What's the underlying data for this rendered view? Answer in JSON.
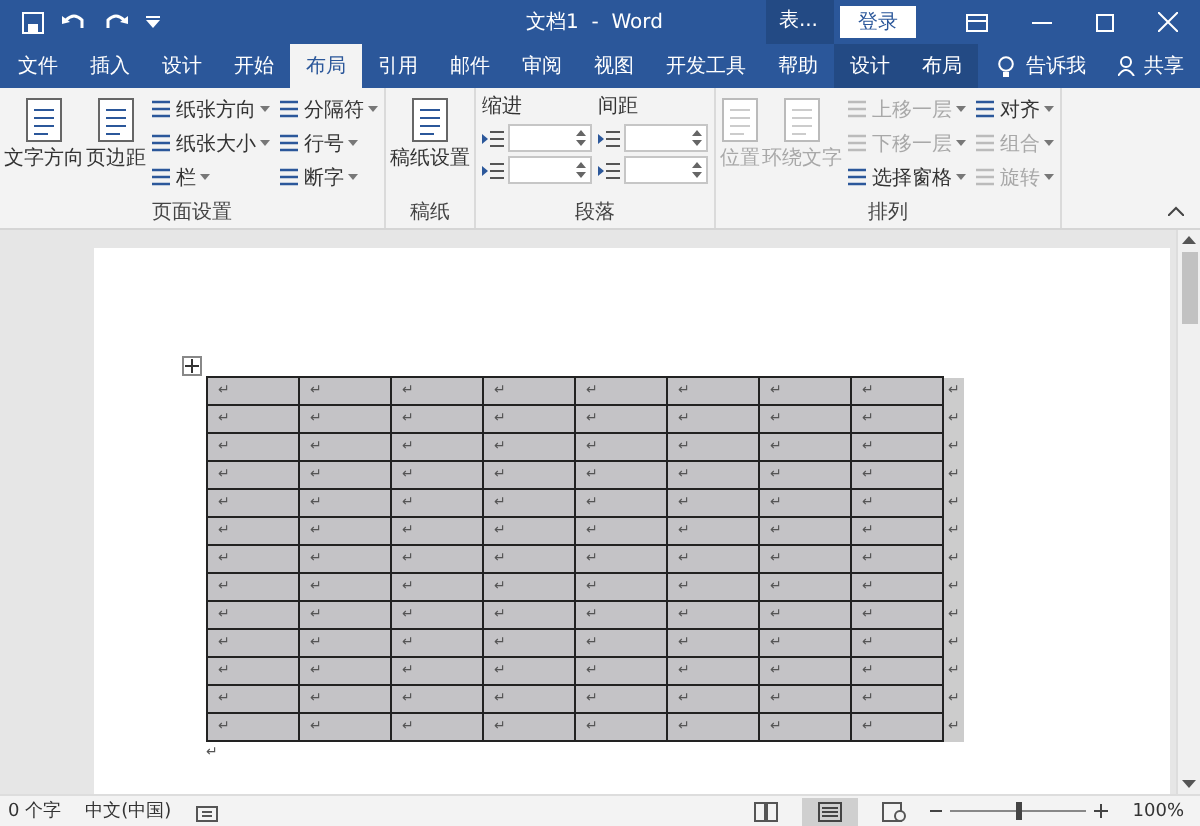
{
  "title_bar": {
    "title": "文档1  -  Word",
    "context_label": "表...",
    "login": "登录"
  },
  "tabs": [
    {
      "label": "文件",
      "selected": false,
      "kind": "normal"
    },
    {
      "label": "插入",
      "selected": false,
      "kind": "normal"
    },
    {
      "label": "设计",
      "selected": false,
      "kind": "normal"
    },
    {
      "label": "开始",
      "selected": false,
      "kind": "normal"
    },
    {
      "label": "布局",
      "selected": true,
      "kind": "normal"
    },
    {
      "label": "引用",
      "selected": false,
      "kind": "normal"
    },
    {
      "label": "邮件",
      "selected": false,
      "kind": "normal"
    },
    {
      "label": "审阅",
      "selected": false,
      "kind": "normal"
    },
    {
      "label": "视图",
      "selected": false,
      "kind": "normal"
    },
    {
      "label": "开发工具",
      "selected": false,
      "kind": "normal"
    },
    {
      "label": "帮助",
      "selected": false,
      "kind": "normal"
    },
    {
      "label": "设计",
      "selected": false,
      "kind": "context"
    },
    {
      "label": "布局",
      "selected": false,
      "kind": "context"
    }
  ],
  "tell_me": "告诉我",
  "share": "共享",
  "ribbon": [
    {
      "title": "页面设置",
      "items": [
        {
          "label": "文字方向",
          "kind": "large",
          "disabled": false
        },
        {
          "label": "页边距",
          "kind": "large",
          "disabled": false
        },
        {
          "label": "纸张方向",
          "kind": "small",
          "disabled": false
        },
        {
          "label": "纸张大小",
          "kind": "small",
          "disabled": false
        },
        {
          "label": "栏",
          "kind": "small",
          "disabled": false
        },
        {
          "label": "分隔符",
          "kind": "small",
          "disabled": false
        },
        {
          "label": "行号",
          "kind": "small",
          "disabled": false
        },
        {
          "label": "断字",
          "kind": "small",
          "disabled": false
        }
      ]
    },
    {
      "title": "稿纸",
      "items": [
        {
          "label": "稿纸设置",
          "kind": "large",
          "disabled": false
        }
      ]
    },
    {
      "title": "段落",
      "items": [
        {
          "label": "缩进",
          "kind": "spinners"
        },
        {
          "label": "间距",
          "kind": "spinners"
        }
      ]
    },
    {
      "title": "排列",
      "items": [
        {
          "label": "位置",
          "kind": "large",
          "disabled": true
        },
        {
          "label": "环绕文字",
          "kind": "large",
          "disabled": true
        },
        {
          "label": "上移一层",
          "kind": "small",
          "disabled": true
        },
        {
          "label": "下移一层",
          "kind": "small",
          "disabled": true
        },
        {
          "label": "选择窗格",
          "kind": "small",
          "disabled": false
        },
        {
          "label": "对齐",
          "kind": "small",
          "disabled": false
        },
        {
          "label": "组合",
          "kind": "small",
          "disabled": true
        },
        {
          "label": "旋转",
          "kind": "small",
          "disabled": true
        }
      ]
    }
  ],
  "table": {
    "selected": true,
    "rows": [
      {
        "cells": [
          "↵",
          "↵",
          "↵",
          "↵",
          "↵",
          "↵",
          "↵",
          "↵"
        ],
        "end": "↵"
      },
      {
        "cells": [
          "↵",
          "↵",
          "↵",
          "↵",
          "↵",
          "↵",
          "↵",
          "↵"
        ],
        "end": "↵"
      },
      {
        "cells": [
          "↵",
          "↵",
          "↵",
          "↵",
          "↵",
          "↵",
          "↵",
          "↵"
        ],
        "end": "↵"
      },
      {
        "cells": [
          "↵",
          "↵",
          "↵",
          "↵",
          "↵",
          "↵",
          "↵",
          "↵"
        ],
        "end": "↵"
      },
      {
        "cells": [
          "↵",
          "↵",
          "↵",
          "↵",
          "↵",
          "↵",
          "↵",
          "↵"
        ],
        "end": "↵"
      },
      {
        "cells": [
          "↵",
          "↵",
          "↵",
          "↵",
          "↵",
          "↵",
          "↵",
          "↵"
        ],
        "end": "↵"
      },
      {
        "cells": [
          "↵",
          "↵",
          "↵",
          "↵",
          "↵",
          "↵",
          "↵",
          "↵"
        ],
        "end": "↵"
      },
      {
        "cells": [
          "↵",
          "↵",
          "↵",
          "↵",
          "↵",
          "↵",
          "↵",
          "↵"
        ],
        "end": "↵"
      },
      {
        "cells": [
          "↵",
          "↵",
          "↵",
          "↵",
          "↵",
          "↵",
          "↵",
          "↵"
        ],
        "end": "↵"
      },
      {
        "cells": [
          "↵",
          "↵",
          "↵",
          "↵",
          "↵",
          "↵",
          "↵",
          "↵"
        ],
        "end": "↵"
      },
      {
        "cells": [
          "↵",
          "↵",
          "↵",
          "↵",
          "↵",
          "↵",
          "↵",
          "↵"
        ],
        "end": "↵"
      },
      {
        "cells": [
          "↵",
          "↵",
          "↵",
          "↵",
          "↵",
          "↵",
          "↵",
          "↵"
        ],
        "end": "↵"
      },
      {
        "cells": [
          "↵",
          "↵",
          "↵",
          "↵",
          "↵",
          "↵",
          "↵",
          "↵"
        ],
        "end": "↵"
      }
    ]
  },
  "end_mark": "↵",
  "status_bar": {
    "word_count": "0 个字",
    "language": "中文(中国)",
    "zoom": {
      "level": 0.5,
      "reading": "100%"
    }
  }
}
